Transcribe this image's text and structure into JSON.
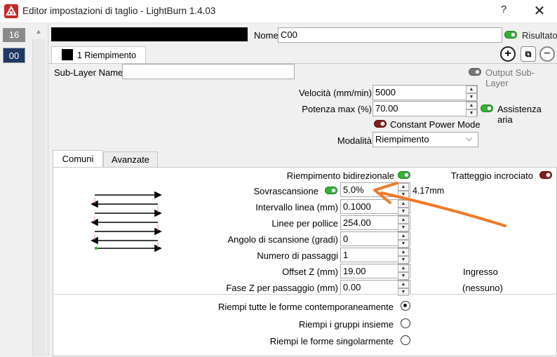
{
  "window": {
    "title": "Editor impostazioni di taglio - LightBurn 1.4.03",
    "help_glyph": "?",
    "close_glyph": "✕"
  },
  "layers": [
    {
      "label": "16"
    },
    {
      "label": "00"
    }
  ],
  "header": {
    "name_label": "Nome",
    "name_value": "C00",
    "result_label": "Risultato"
  },
  "sublayer_tab": {
    "label": "1 Riempimento"
  },
  "buttons": {
    "add": "+",
    "copy": "⧉",
    "remove": "−"
  },
  "sublayer": {
    "name_label": "Sub-Layer Name",
    "name_value": "",
    "output_label": "Output Sub-Layer"
  },
  "params": {
    "speed_label": "Velocità (mm/min)",
    "speed_value": "5000",
    "power_label": "Potenza max (%)",
    "power_value": "70.00",
    "air_label": "Assistenza aria",
    "cpm_label": "Constant Power Mode",
    "mode_label": "Modalità",
    "mode_value": "Riempimento"
  },
  "tabs": [
    {
      "label": "Comuni"
    },
    {
      "label": "Avanzate"
    }
  ],
  "common": {
    "bidir_label": "Riempimento bidirezionale",
    "cross_label": "Tratteggio incrociato",
    "overscan_label": "Sovrascansione",
    "overscan_value": "5.0%",
    "overscan_mm": "4.17mm",
    "interval_label": "Intervallo linea (mm)",
    "interval_value": "0.1000",
    "lpi_label": "Linee per pollice",
    "lpi_value": "254.00",
    "angle_label": "Angolo di scansione (gradi)",
    "angle_value": "0",
    "passes_label": "Numero di passaggi",
    "passes_value": "1",
    "offsetz_label": "Offset Z (mm)",
    "offsetz_value": "19.00",
    "zstep_label": "Fase Z per passaggio (mm)",
    "zstep_value": "0.00",
    "ingresso_label": "Ingresso",
    "nessuno_label": "(nessuno)"
  },
  "fill_options": {
    "all_label": "Riempi tutte le forme contemporaneamente",
    "groups_label": "Riempi i gruppi insieme",
    "single_label": "Riempi le forme singolarmente"
  },
  "colors": {
    "toggle_on": "#2fb52f",
    "toggle_off": "#777777",
    "toggle_red": "#8b1a1a",
    "annotation_arrow": "#f07a28",
    "selected_layer": "#1f3864"
  }
}
